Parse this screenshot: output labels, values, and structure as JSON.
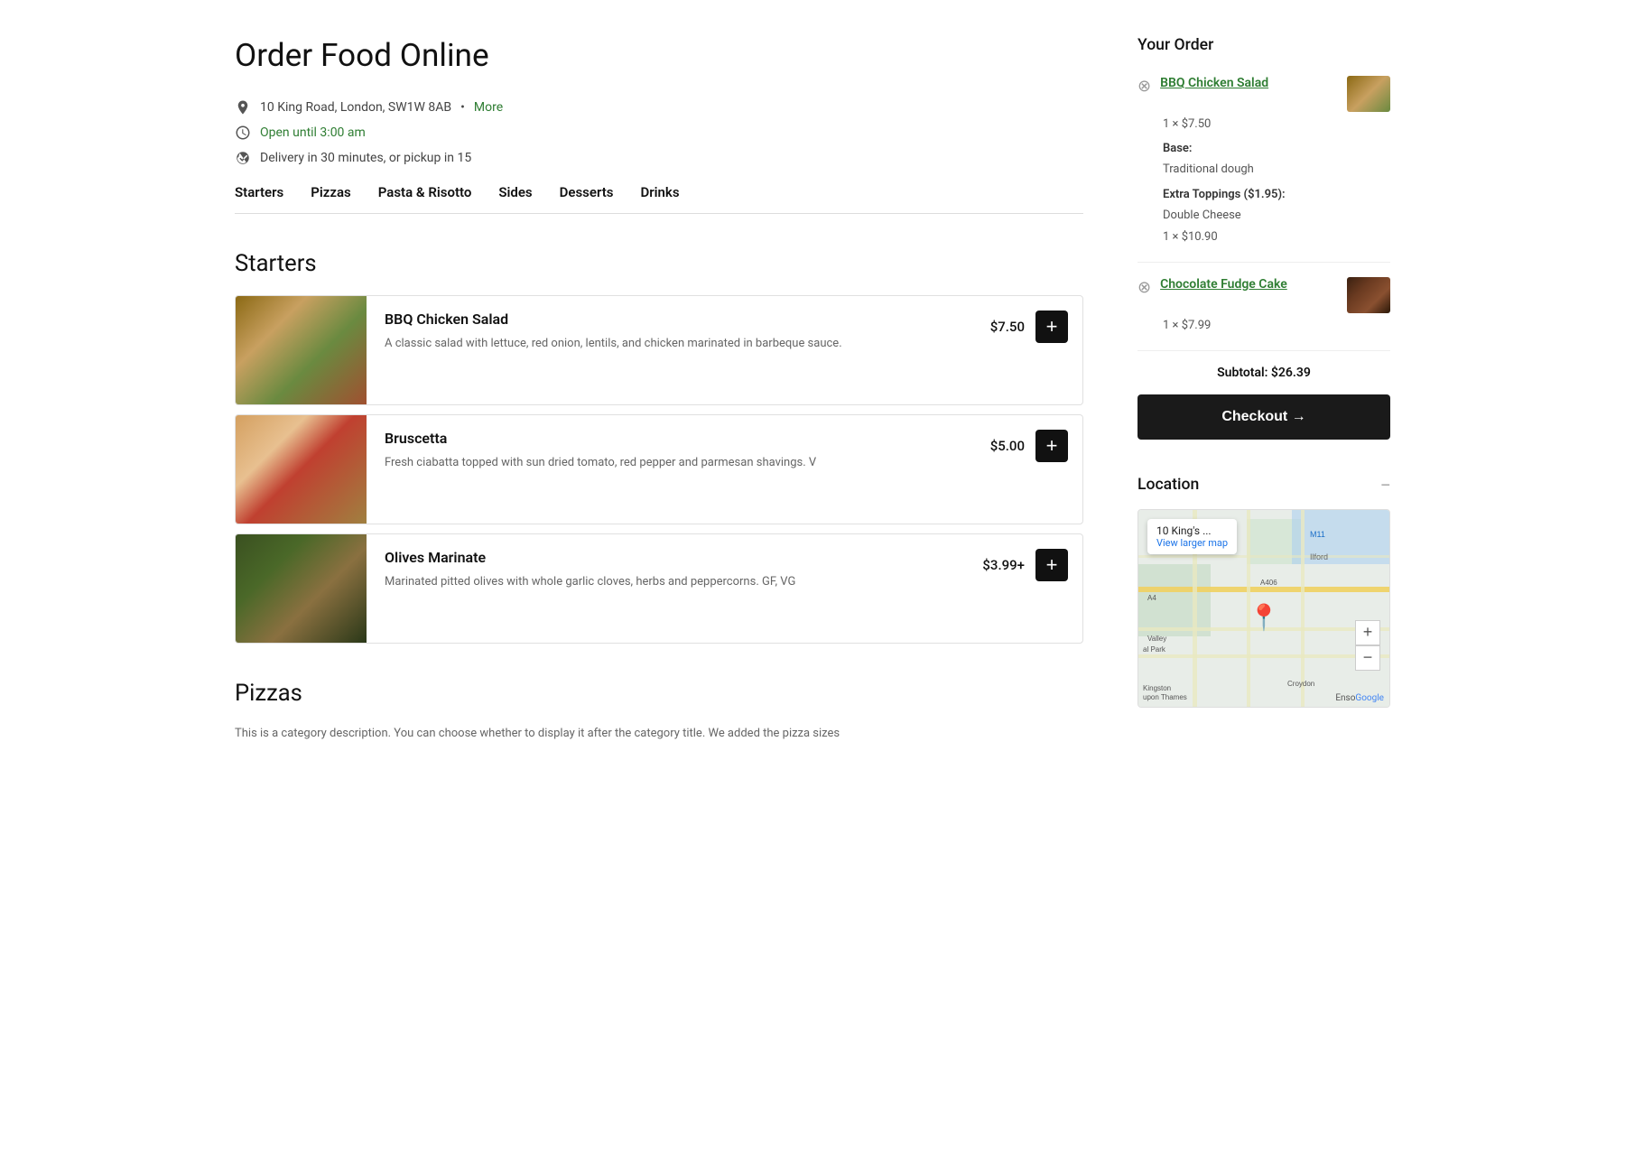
{
  "page": {
    "title": "Order Food Online"
  },
  "address": {
    "text": "10 King Road, London, SW1W 8AB",
    "more_label": "More"
  },
  "hours": {
    "text": "Open until 3:00 am"
  },
  "delivery": {
    "text": "Delivery in 30 minutes, or pickup in 15"
  },
  "nav": {
    "items": [
      {
        "label": "Starters",
        "id": "starters"
      },
      {
        "label": "Pizzas",
        "id": "pizzas"
      },
      {
        "label": "Pasta & Risotto",
        "id": "pasta"
      },
      {
        "label": "Sides",
        "id": "sides"
      },
      {
        "label": "Desserts",
        "id": "desserts"
      },
      {
        "label": "Drinks",
        "id": "drinks"
      }
    ]
  },
  "starters": {
    "title": "Starters",
    "items": [
      {
        "name": "BBQ Chicken Salad",
        "description": "A classic salad with lettuce, red onion, lentils, and chicken marinated in barbeque sauce.",
        "price": "$7.50",
        "img_class": "img-bbq"
      },
      {
        "name": "Bruscetta",
        "description": "Fresh ciabatta topped with sun dried tomato, red pepper and parmesan shavings. V",
        "price": "$5.00",
        "img_class": "img-bruscetta"
      },
      {
        "name": "Olives Marinate",
        "description": "Marinated pitted olives with whole garlic cloves, herbs and peppercorns. GF, VG",
        "price": "$3.99+",
        "img_class": "img-olives"
      }
    ],
    "add_label": "+"
  },
  "pizzas": {
    "title": "Pizzas",
    "description": "This is a category description. You can choose whether to display it after the category title. We added the pizza sizes"
  },
  "order": {
    "title": "Your Order",
    "items": [
      {
        "name": "BBQ Chicken Salad",
        "qty_label": "1 × $7.50",
        "details": {
          "base_label": "Base:",
          "base_value": "Traditional dough",
          "extra_label": "Extra Toppings ($1.95):",
          "extra_value": "Double Cheese",
          "subtotal": "1 × $10.90"
        },
        "thumb_class": "thumb-bbq"
      },
      {
        "name": "Chocolate Fudge Cake",
        "qty_label": "1 × $7.99",
        "details": null,
        "thumb_class": "thumb-choc"
      }
    ],
    "subtotal_label": "Subtotal: $26.39",
    "checkout_label": "Checkout →"
  },
  "location": {
    "title": "Location",
    "map_name": "10 King's ...",
    "map_link": "View larger map",
    "google_label": "Google"
  }
}
